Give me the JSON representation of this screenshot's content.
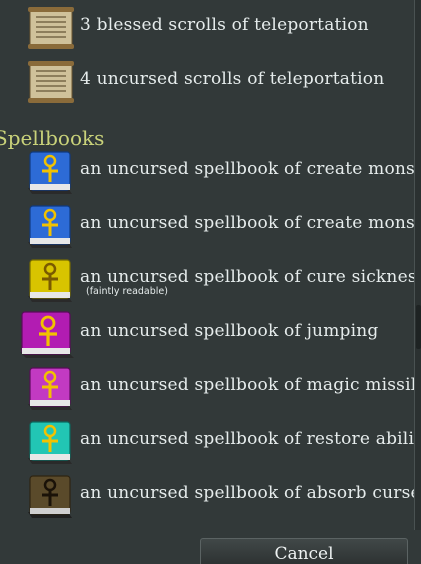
{
  "items_top": [
    {
      "label": "3 blessed scrolls of teleportation",
      "icon": "scroll-icon"
    },
    {
      "label": "4 uncursed scrolls of teleportation",
      "icon": "scroll-icon"
    }
  ],
  "section": {
    "title": "Spellbooks"
  },
  "spellbooks": [
    {
      "label": "an uncursed spellbook of create monster",
      "sub": "",
      "color": "#2d6bd6",
      "icon": "blue-spellbook-icon"
    },
    {
      "label": "an uncursed spellbook of create monster",
      "sub": "",
      "color": "#2d6bd6",
      "icon": "blue-spellbook-icon"
    },
    {
      "label": "an uncursed spellbook of cure sickness",
      "sub": "(faintly readable)",
      "color": "#d8c400",
      "icon": "yellow-spellbook-icon"
    },
    {
      "label": "an uncursed spellbook of jumping",
      "sub": "",
      "color": "#b21cb2",
      "icon": "magenta-spellbook-icon"
    },
    {
      "label": "an uncursed spellbook of magic missile",
      "sub": "",
      "color": "#c23ac2",
      "icon": "magenta-spellbook-icon"
    },
    {
      "label": "an uncursed spellbook of restore ability",
      "sub": "",
      "color": "#22c6b4",
      "icon": "cyan-spellbook-icon"
    },
    {
      "label": "an uncursed spellbook of absorb curse",
      "sub": "",
      "color": "#5a4a2a",
      "icon": "brown-spellbook-icon"
    }
  ],
  "cancel_label": "Cancel",
  "colors": {
    "background": "#323939",
    "section_header": "#c9d27a",
    "text": "#e6ecec"
  }
}
